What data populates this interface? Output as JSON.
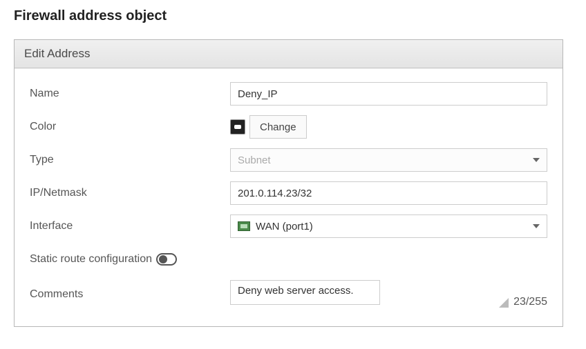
{
  "page": {
    "title": "Firewall address object"
  },
  "panel": {
    "header": "Edit Address"
  },
  "form": {
    "name": {
      "label": "Name",
      "value": "Deny_IP"
    },
    "color": {
      "label": "Color",
      "change_btn": "Change",
      "swatch_name": "color-swatch-black"
    },
    "type": {
      "label": "Type",
      "value": "Subnet"
    },
    "ip_netmask": {
      "label": "IP/Netmask",
      "value": "201.0.114.23/32"
    },
    "interface": {
      "label": "Interface",
      "value": "WAN (port1)",
      "icon_name": "interface-wan-icon"
    },
    "static_route": {
      "label": "Static route configuration",
      "on": false
    },
    "comments": {
      "label": "Comments",
      "value": "Deny web server access.",
      "count": "23/255"
    }
  }
}
